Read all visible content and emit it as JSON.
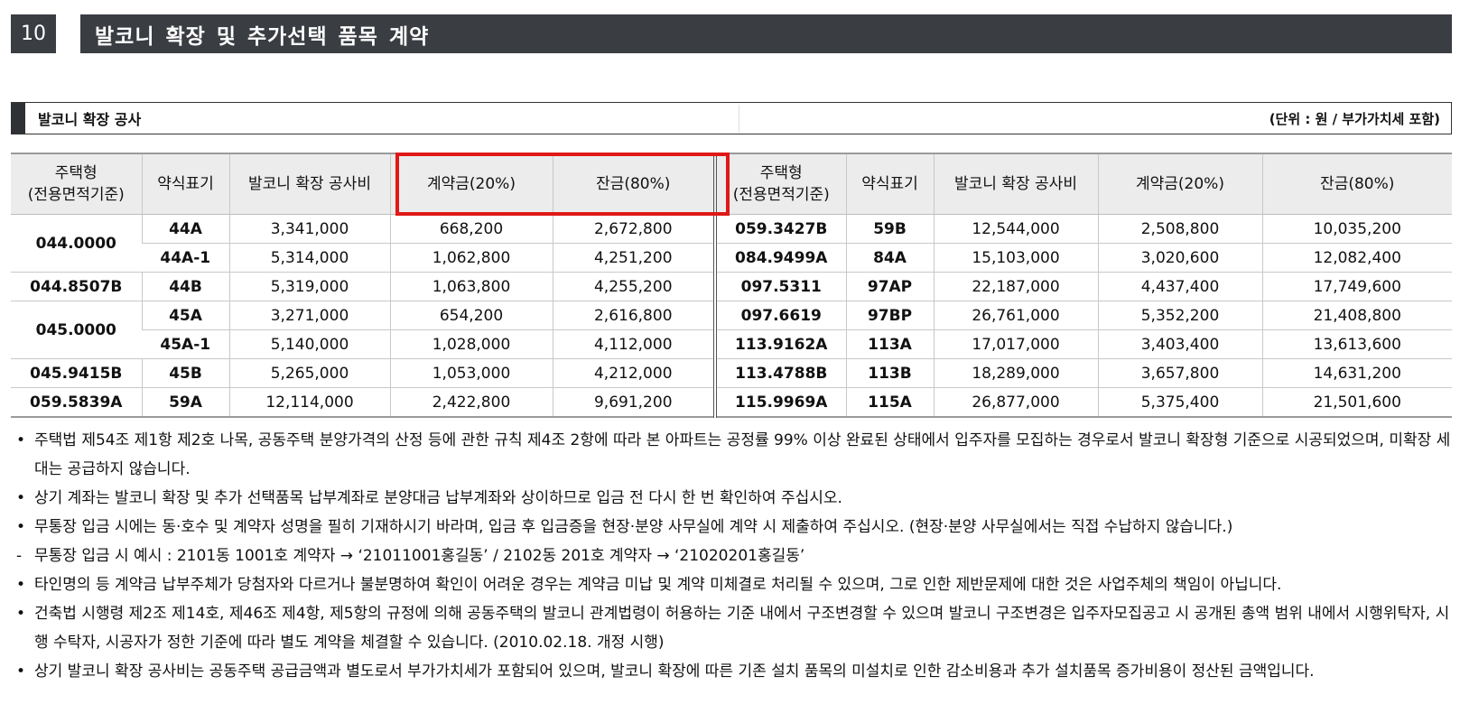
{
  "section": {
    "number": "10",
    "title": "발코니 확장 및 추가선택 품목 계약"
  },
  "subheader": {
    "title": "발코니 확장 공사",
    "unit": "(단위 : 원 / 부가가치세 포함)"
  },
  "table": {
    "headers": [
      "주택형\n(전용면적기준)",
      "약식표기",
      "발코니 확장 공사비",
      "계약금(20%)",
      "잔금(80%)",
      "주택형\n(전용면적기준)",
      "약식표기",
      "발코니 확장 공사비",
      "계약금(20%)",
      "잔금(80%)"
    ],
    "rows": [
      {
        "left": {
          "type": "044.0000",
          "abbr": "44A",
          "cost": "3,341,000",
          "deposit": "668,200",
          "balance": "2,672,800"
        },
        "right": {
          "type": "059.3427B",
          "abbr": "59B",
          "cost": "12,544,000",
          "deposit": "2,508,800",
          "balance": "10,035,200"
        }
      },
      {
        "left": {
          "type": "",
          "abbr": "44A-1",
          "cost": "5,314,000",
          "deposit": "1,062,800",
          "balance": "4,251,200"
        },
        "right": {
          "type": "084.9499A",
          "abbr": "84A",
          "cost": "15,103,000",
          "deposit": "3,020,600",
          "balance": "12,082,400"
        }
      },
      {
        "left": {
          "type": "044.8507B",
          "abbr": "44B",
          "cost": "5,319,000",
          "deposit": "1,063,800",
          "balance": "4,255,200"
        },
        "right": {
          "type": "097.5311",
          "abbr": "97AP",
          "cost": "22,187,000",
          "deposit": "4,437,400",
          "balance": "17,749,600"
        }
      },
      {
        "left": {
          "type": "045.0000",
          "abbr": "45A",
          "cost": "3,271,000",
          "deposit": "654,200",
          "balance": "2,616,800"
        },
        "right": {
          "type": "097.6619",
          "abbr": "97BP",
          "cost": "26,761,000",
          "deposit": "5,352,200",
          "balance": "21,408,800"
        }
      },
      {
        "left": {
          "type": "",
          "abbr": "45A-1",
          "cost": "5,140,000",
          "deposit": "1,028,000",
          "balance": "4,112,000"
        },
        "right": {
          "type": "113.9162A",
          "abbr": "113A",
          "cost": "17,017,000",
          "deposit": "3,403,400",
          "balance": "13,613,600"
        }
      },
      {
        "left": {
          "type": "045.9415B",
          "abbr": "45B",
          "cost": "5,265,000",
          "deposit": "1,053,000",
          "balance": "4,212,000"
        },
        "right": {
          "type": "113.4788B",
          "abbr": "113B",
          "cost": "18,289,000",
          "deposit": "3,657,800",
          "balance": "14,631,200"
        }
      },
      {
        "left": {
          "type": "059.5839A",
          "abbr": "59A",
          "cost": "12,114,000",
          "deposit": "2,422,800",
          "balance": "9,691,200"
        },
        "right": {
          "type": "115.9969A",
          "abbr": "115A",
          "cost": "26,877,000",
          "deposit": "5,375,400",
          "balance": "21,501,600"
        }
      }
    ]
  },
  "notes": [
    {
      "bullet": "•",
      "text": "주택법 제54조 제1항 제2호 나목, 공동주택 분양가격의 산정 등에 관한 규칙 제4조 2항에 따라 본 아파트는 공정률 99% 이상 완료된 상태에서 입주자를 모집하는 경우로서 발코니 확장형 기준으로 시공되었으며, 미확장 세대는 공급하지 않습니다."
    },
    {
      "bullet": "•",
      "text": "상기 계좌는 발코니 확장 및 추가 선택품목 납부계좌로 분양대금 납부계좌와 상이하므로 입금 전 다시 한 번 확인하여 주십시오."
    },
    {
      "bullet": "•",
      "text": "무통장 입금 시에는 동·호수 및 계약자 성명을 필히 기재하시기 바라며, 입금 후 입금증을 현장·분양 사무실에 계약 시 제출하여 주십시오. (현장·분양 사무실에서는 직접 수납하지 않습니다.)"
    },
    {
      "bullet": "-",
      "text": "무통장 입금 시 예시 : 2101동 1001호 계약자 → ‘21011001홍길동’ / 2102동 201호 계약자 → ‘21020201홍길동’"
    },
    {
      "bullet": "•",
      "text": "타인명의 등 계약금 납부주체가 당첨자와 다르거나 불분명하여 확인이 어려운 경우는 계약금 미납 및 계약 미체결로 처리될 수 있으며, 그로 인한 제반문제에 대한 것은 사업주체의 책임이 아닙니다."
    },
    {
      "bullet": "•",
      "text": "건축법 시행령 제2조 제14호, 제46조 제4항, 제5항의 규정에 의해 공동주택의 발코니 관계법령이 허용하는 기준 내에서 구조변경할 수 있으며 발코니 구조변경은 입주자모집공고 시 공개된 총액 범위 내에서 시행위탁자, 시행 수탁자, 시공자가 정한 기준에 따라 별도 계약을 체결할 수 있습니다. (2010.02.18. 개정 시행)"
    },
    {
      "bullet": "•",
      "text": "상기 발코니 확장 공사비는 공동주택 공급금액과 별도로서 부가가치세가 포함되어 있으며, 발코니 확장에 따른 기존 설치 품목의 미설치로 인한 감소비용과 추가 설치품목 증가비용이 정산된 금액입니다."
    }
  ],
  "colors": {
    "dark_bar": "#3a3d42",
    "header_bg": "#ececec",
    "highlight": "#e01818"
  }
}
